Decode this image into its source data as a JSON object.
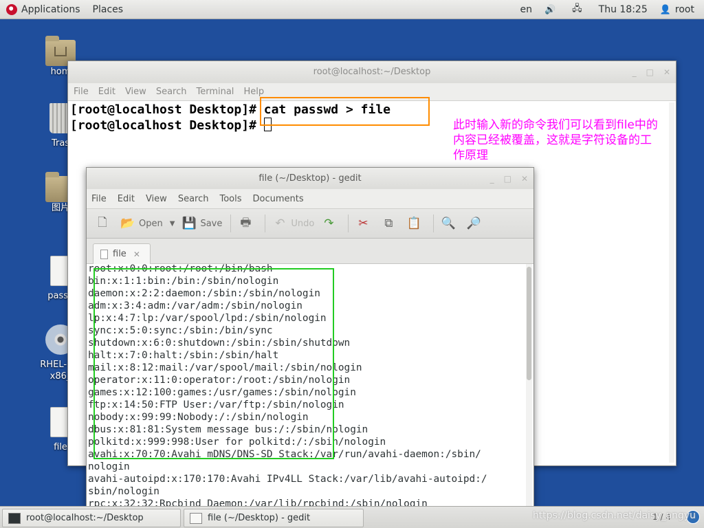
{
  "top_panel": {
    "applications": "Applications",
    "places": "Places",
    "language": "en",
    "clock": "Thu 18:25",
    "user": "root"
  },
  "desktop": {
    "icons": [
      {
        "label": "hom",
        "kind": "home-folder"
      },
      {
        "label": "Tras",
        "kind": "trash"
      },
      {
        "label": "图片",
        "kind": "folder"
      },
      {
        "label": "passv",
        "kind": "document"
      },
      {
        "label": "RHEL-7.3",
        "label2": "x86_",
        "kind": "dvd"
      },
      {
        "label": "file",
        "kind": "document"
      }
    ]
  },
  "terminal": {
    "title": "root@localhost:~/Desktop",
    "menu": [
      "File",
      "Edit",
      "View",
      "Search",
      "Terminal",
      "Help"
    ],
    "lines": [
      "[root@localhost Desktop]# cat passwd > file",
      "[root@localhost Desktop]# "
    ]
  },
  "annotation": {
    "text": "此时输入新的命令我们可以看到file中的内容已经被覆盖，这就是字符设备的工作原理",
    "color": "#ff00ff"
  },
  "gedit": {
    "title": "file (~/Desktop) - gedit",
    "menu": [
      "File",
      "Edit",
      "View",
      "Search",
      "Tools",
      "Documents"
    ],
    "toolbar": {
      "open": "Open",
      "save": "Save",
      "undo": "Undo"
    },
    "tab_label": "file",
    "lines": [
      "root:x:0:0:root:/root:/bin/bash",
      "bin:x:1:1:bin:/bin:/sbin/nologin",
      "daemon:x:2:2:daemon:/sbin:/sbin/nologin",
      "adm:x:3:4:adm:/var/adm:/sbin/nologin",
      "lp:x:4:7:lp:/var/spool/lpd:/sbin/nologin",
      "sync:x:5:0:sync:/sbin:/bin/sync",
      "shutdown:x:6:0:shutdown:/sbin:/sbin/shutdown",
      "halt:x:7:0:halt:/sbin:/sbin/halt",
      "mail:x:8:12:mail:/var/spool/mail:/sbin/nologin",
      "operator:x:11:0:operator:/root:/sbin/nologin",
      "games:x:12:100:games:/usr/games:/sbin/nologin",
      "ftp:x:14:50:FTP User:/var/ftp:/sbin/nologin",
      "nobody:x:99:99:Nobody:/:/sbin/nologin",
      "dbus:x:81:81:System message bus:/:/sbin/nologin",
      "polkitd:x:999:998:User for polkitd:/:/sbin/nologin",
      "avahi:x:70:70:Avahi mDNS/DNS-SD Stack:/var/run/avahi-daemon:/sbin/",
      "nologin",
      "avahi-autoipd:x:170:170:Avahi IPv4LL Stack:/var/lib/avahi-autoipd:/",
      "sbin/nologin",
      "rpc:x:32:32:Rpcbind Daemon:/var/lib/rpcbind:/sbin/nologin"
    ]
  },
  "taskbar": {
    "tasks": [
      "root@localhost:~/Desktop",
      "file (~/Desktop) - gedit"
    ],
    "pager": "1 / 4",
    "watermark": "https://blog.csdn.net/daisy_angyu"
  },
  "colors": {
    "highlight_command": "#ff8c00",
    "highlight_content": "#22cc22",
    "desktop": "#1f4e9c"
  }
}
